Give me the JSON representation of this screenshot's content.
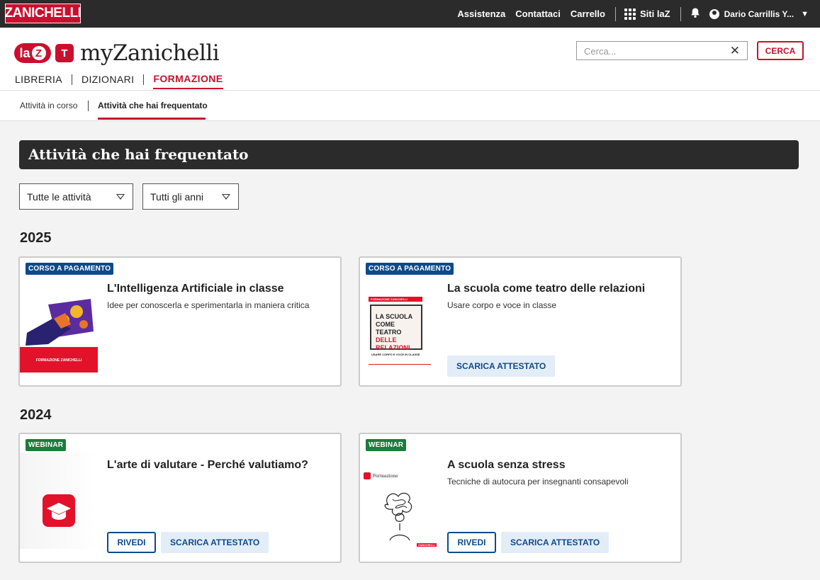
{
  "topbar": {
    "logo": "ZANICHELLI",
    "links": [
      "Assistenza",
      "Contattaci",
      "Carrello"
    ],
    "siti": "Siti laZ",
    "user": "Dario Carrillis Y...",
    "colors": {
      "bar": "#2b2b2b",
      "brand": "#c8102e"
    }
  },
  "header": {
    "laz_text": "la",
    "laz_z": "Z",
    "t_glyph": "T",
    "brand_name": "myZanichelli",
    "search_placeholder": "Cerca...",
    "search_button": "CERCA",
    "nav": [
      {
        "label": "LIBRERIA"
      },
      {
        "label": "DIZIONARI"
      },
      {
        "label": "FORMAZIONE"
      }
    ]
  },
  "subnav": {
    "items": [
      "Attività in corso",
      "Attività che hai frequentato"
    ]
  },
  "main": {
    "title": "Attività che hai frequentato",
    "filters": [
      "Tutte le attività",
      "Tutti gli anni"
    ],
    "sections": [
      {
        "year": "2025",
        "cards": [
          {
            "badge": "CORSO A PAGAMENTO",
            "title": "L'Intelligenza Artificiale in classe",
            "subtitle": "Idee per conoscerla e sperimentarla in maniera critica",
            "thumb_caption": "FORMAZIONE ZANICHELLI"
          },
          {
            "badge": "CORSO A PAGAMENTO",
            "title": "La scuola come teatro delle relazioni",
            "subtitle": "Usare corpo e voce in classe",
            "thumb_header": "FORMAZIONE ZANICHELLI",
            "thumb_lines": [
              "LA SCUOLA",
              "COME TEATRO",
              "DELLE RELAZIONI"
            ],
            "thumb_footer": "USARE CORPO E VOCE IN CLASSE",
            "button": "SCARICA ATTESTATO"
          }
        ]
      },
      {
        "year": "2024",
        "cards": [
          {
            "badge": "WEBINAR",
            "title": "L'arte di valutare - Perché valutiamo?",
            "subtitle": "",
            "button_out": "RIVEDI",
            "button": "SCARICA ATTESTATO"
          },
          {
            "badge": "WEBINAR",
            "title": "A scuola senza stress",
            "subtitle": "Tecniche di autocura per insegnanti consapevoli",
            "thumb_label": "Formazione",
            "thumb_footer": "ZANICHELLI",
            "button_out": "RIVEDI",
            "button": "SCARICA ATTESTATO"
          }
        ]
      }
    ]
  }
}
